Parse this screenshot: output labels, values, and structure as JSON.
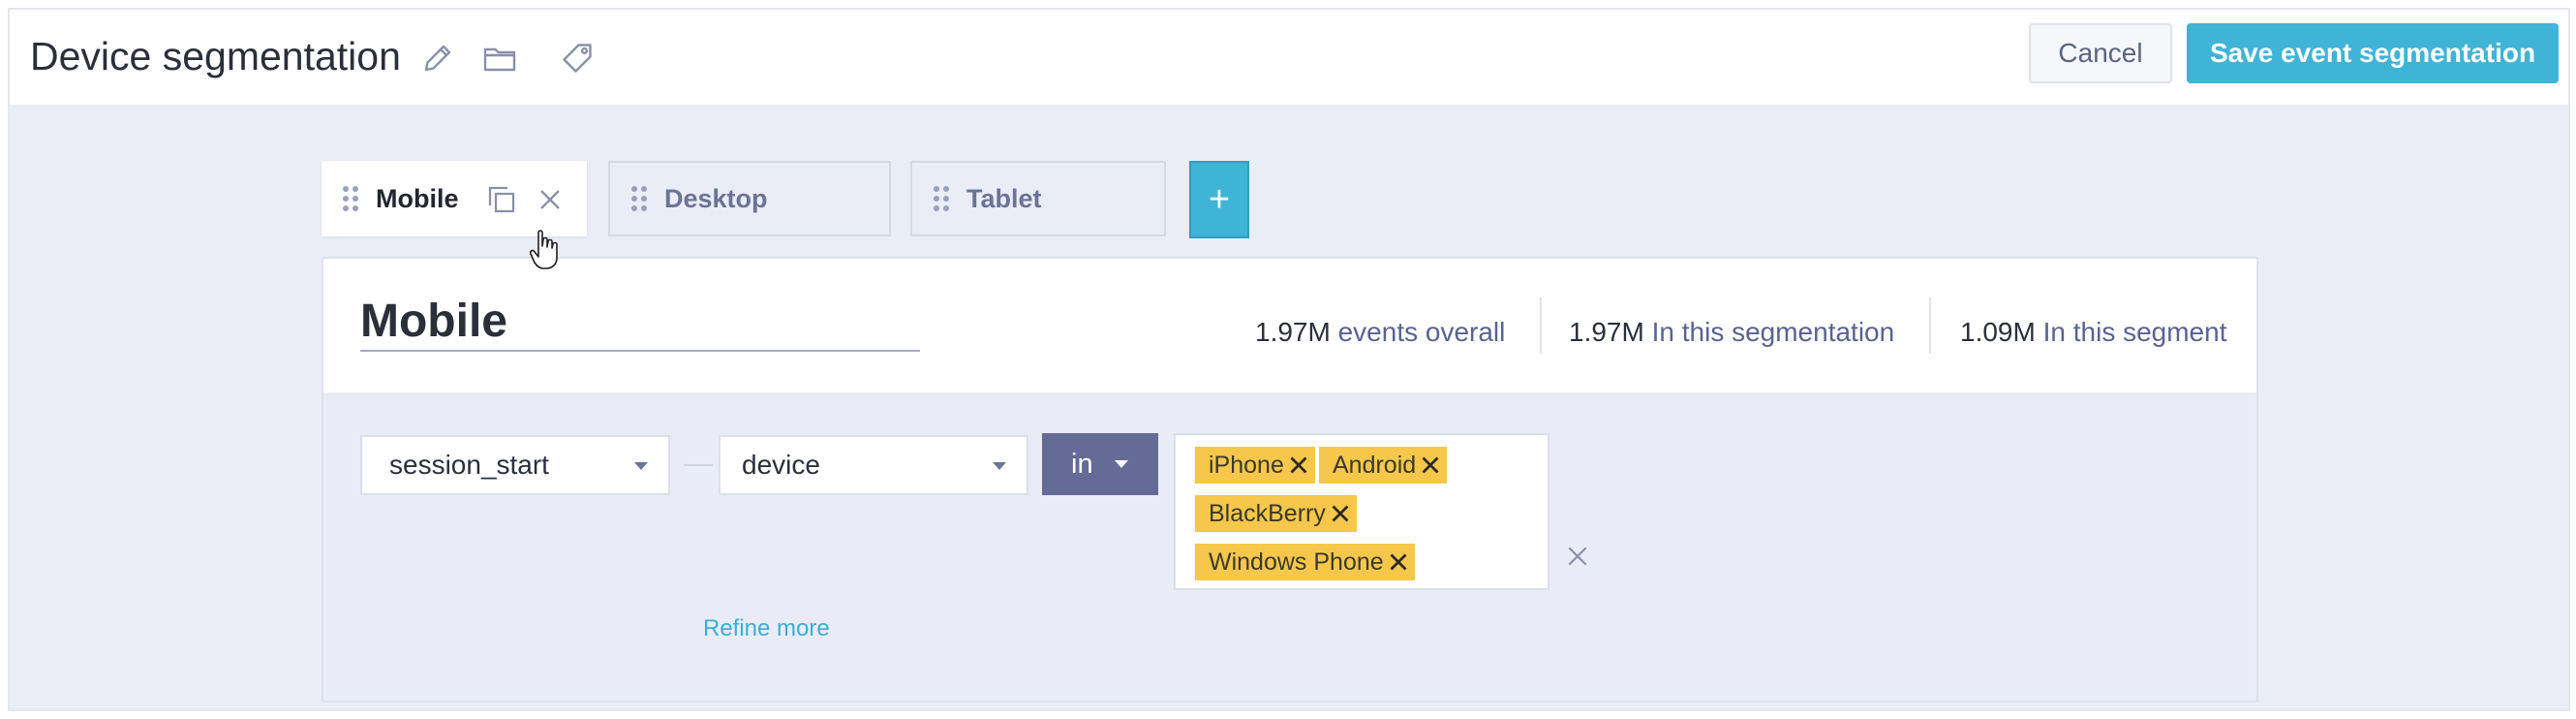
{
  "header": {
    "title": "Device segmentation",
    "icons": [
      "pencil-icon",
      "folder-icon",
      "tag-icon"
    ],
    "cancel_label": "Cancel",
    "save_label": "Save event segmentation"
  },
  "tabs": [
    {
      "label": "Mobile",
      "active": true
    },
    {
      "label": "Desktop",
      "active": false
    },
    {
      "label": "Tablet",
      "active": false
    }
  ],
  "add_tab_label": "+",
  "segment": {
    "name": "Mobile",
    "stats": [
      {
        "value": "1.97M",
        "label": "events overall"
      },
      {
        "value": "1.97M",
        "label": "In this segmentation"
      },
      {
        "value": "1.09M",
        "label": "In this segment"
      }
    ],
    "rule": {
      "event": "session_start",
      "property": "device",
      "operator": "in",
      "values": [
        "iPhone",
        "Android",
        "BlackBerry",
        "Windows Phone"
      ]
    },
    "refine_label": "Refine more"
  },
  "colors": {
    "accent": "#3fb4d6",
    "operator_bg": "#636b96",
    "chip_bg": "#f6c74a",
    "canvas_bg": "#eaedf6"
  }
}
